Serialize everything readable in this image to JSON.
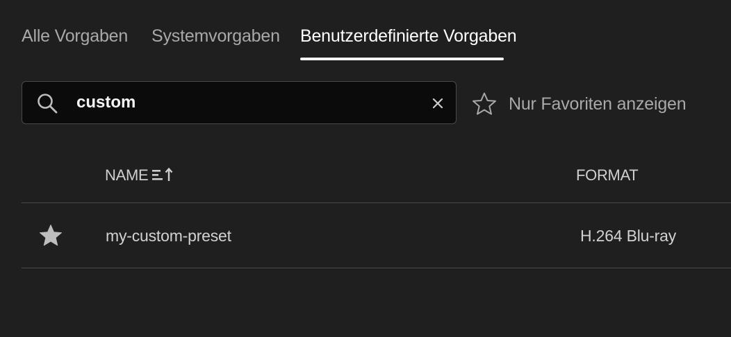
{
  "tabs": [
    {
      "label": "Alle Vorgaben",
      "active": false
    },
    {
      "label": "Systemvorgaben",
      "active": false
    },
    {
      "label": "Benutzerdefinierte Vorgaben",
      "active": true
    }
  ],
  "search": {
    "value": "custom",
    "placeholder": "",
    "icon": "search-icon",
    "clear_icon": "close-icon"
  },
  "favorites": {
    "label": "Nur Favoriten anzeigen",
    "icon": "star-outline-icon"
  },
  "table": {
    "columns": {
      "name": "NAME",
      "format": "FORMAT"
    },
    "sort_icon": "sort-ascending-icon",
    "rows": [
      {
        "favorite": true,
        "name": "my-custom-preset",
        "format": "H.264 Blu-ray"
      }
    ]
  },
  "colors": {
    "background": "#1f1f1f",
    "search_background": "#0b0b0b",
    "active_tab": "#ffffff",
    "inactive_text": "#a9a9a9",
    "divider": "#4a4a4a"
  }
}
